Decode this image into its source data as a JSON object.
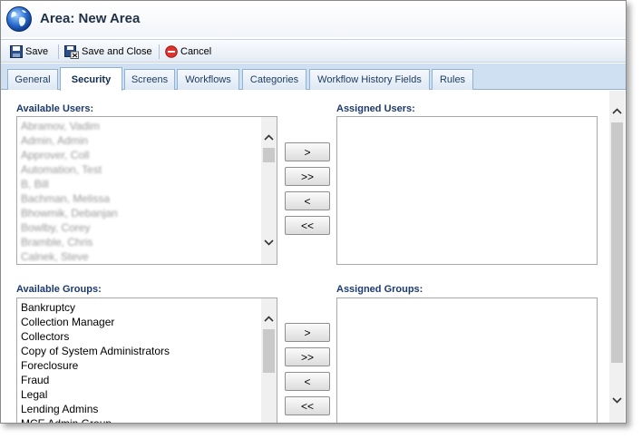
{
  "window": {
    "title": "Area: New Area"
  },
  "toolbar": {
    "save_label": "Save",
    "save_close_label": "Save and Close",
    "cancel_label": "Cancel"
  },
  "tabs": [
    {
      "label": "General",
      "active": false
    },
    {
      "label": "Security",
      "active": true
    },
    {
      "label": "Screens",
      "active": false
    },
    {
      "label": "Workflows",
      "active": false
    },
    {
      "label": "Categories",
      "active": false
    },
    {
      "label": "Workflow History Fields",
      "active": false
    },
    {
      "label": "Rules",
      "active": false
    }
  ],
  "users": {
    "available_label": "Available Users:",
    "assigned_label": "Assigned Users:",
    "available": [
      "Abramov, Vadim",
      "Admin, Admin",
      "Approver, Coll",
      "Automation, Test",
      "B, Bill",
      "Bachman, Melissa",
      "Bhowmik, Debanjan",
      "Bowlby, Corey",
      "Bramble, Chris",
      "Calnek, Steve"
    ],
    "assigned": []
  },
  "groups": {
    "available_label": "Available Groups:",
    "assigned_label": "Assigned Groups:",
    "available": [
      "Bankruptcy",
      "Collection Manager",
      "Collectors",
      "Copy of System Administrators",
      "Foreclosure",
      "Fraud",
      "Legal",
      "Lending Admins",
      "MCE Admin Group"
    ],
    "assigned": []
  },
  "move_buttons": {
    "add": ">",
    "add_all": ">>",
    "remove": "<",
    "remove_all": "<<"
  },
  "colors": {
    "label_blue": "#1c3a6e",
    "tab_strip": "#cfe0f2",
    "title_text": "#1f2f45"
  }
}
